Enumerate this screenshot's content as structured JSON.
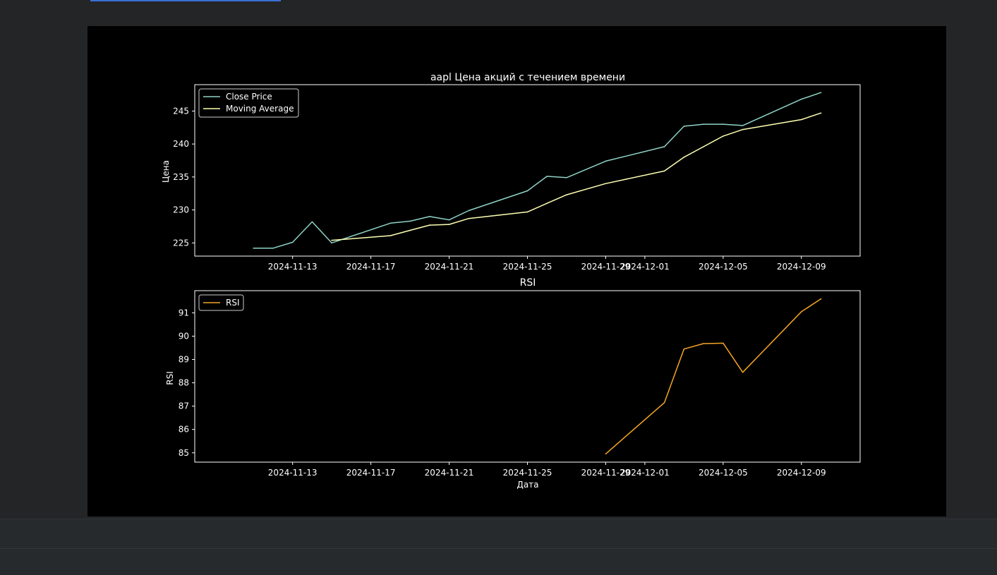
{
  "colors": {
    "close": "#8dd3c7",
    "ma": "#feffb3",
    "rsi": "#f5a623",
    "axes": "#ffffff",
    "background": "#000000"
  },
  "chart_data": [
    {
      "type": "line",
      "title": "aapl Цена акций с течением времени",
      "xlabel": "",
      "ylabel": "Цена",
      "xlim": [
        "2024-11-08",
        "2024-12-12"
      ],
      "ylim": [
        223.0,
        249.0
      ],
      "xticks": [
        "2024-11-13",
        "2024-11-17",
        "2024-11-21",
        "2024-11-25",
        "2024-11-29",
        "2024-12-01",
        "2024-12-05",
        "2024-12-09"
      ],
      "yticks": [
        225,
        230,
        235,
        240,
        245
      ],
      "legend": "upper-left",
      "series": [
        {
          "name": "Close Price",
          "color": "#8dd3c7",
          "x": [
            "2024-11-11",
            "2024-11-12",
            "2024-11-13",
            "2024-11-14",
            "2024-11-15",
            "2024-11-18",
            "2024-11-19",
            "2024-11-20",
            "2024-11-21",
            "2024-11-22",
            "2024-11-25",
            "2024-11-26",
            "2024-11-27",
            "2024-11-29",
            "2024-12-02",
            "2024-12-03",
            "2024-12-04",
            "2024-12-05",
            "2024-12-06",
            "2024-12-09",
            "2024-12-10"
          ],
          "y": [
            224.2,
            224.2,
            225.1,
            228.2,
            225.0,
            228.0,
            228.3,
            229.0,
            228.5,
            229.9,
            232.9,
            235.1,
            234.9,
            237.4,
            239.6,
            242.7,
            243.0,
            243.0,
            242.8,
            246.8,
            247.8
          ]
        },
        {
          "name": "Moving Average",
          "color": "#feffb3",
          "x": [
            "2024-11-15",
            "2024-11-18",
            "2024-11-19",
            "2024-11-20",
            "2024-11-21",
            "2024-11-22",
            "2024-11-25",
            "2024-11-26",
            "2024-11-27",
            "2024-11-29",
            "2024-12-02",
            "2024-12-03",
            "2024-12-04",
            "2024-12-05",
            "2024-12-06",
            "2024-12-09",
            "2024-12-10"
          ],
          "y": [
            225.4,
            226.1,
            226.9,
            227.7,
            227.8,
            228.7,
            229.7,
            231.0,
            232.3,
            234.0,
            235.9,
            238.0,
            239.6,
            241.2,
            242.2,
            243.7,
            244.7
          ]
        }
      ]
    },
    {
      "type": "line",
      "title": "RSI",
      "xlabel": "Дата",
      "ylabel": "RSI",
      "xlim": [
        "2024-11-08",
        "2024-12-12"
      ],
      "ylim": [
        84.6,
        91.95
      ],
      "xticks": [
        "2024-11-13",
        "2024-11-17",
        "2024-11-21",
        "2024-11-25",
        "2024-11-29",
        "2024-12-01",
        "2024-12-05",
        "2024-12-09"
      ],
      "yticks": [
        85,
        86,
        87,
        88,
        89,
        90,
        91
      ],
      "legend": "upper-left",
      "series": [
        {
          "name": "RSI",
          "color": "#f5a623",
          "x": [
            "2024-11-29",
            "2024-12-02",
            "2024-12-03",
            "2024-12-04",
            "2024-12-05",
            "2024-12-06",
            "2024-12-09",
            "2024-12-10"
          ],
          "y": [
            84.95,
            87.15,
            89.45,
            89.68,
            89.7,
            88.45,
            91.05,
            91.6
          ]
        }
      ]
    }
  ]
}
